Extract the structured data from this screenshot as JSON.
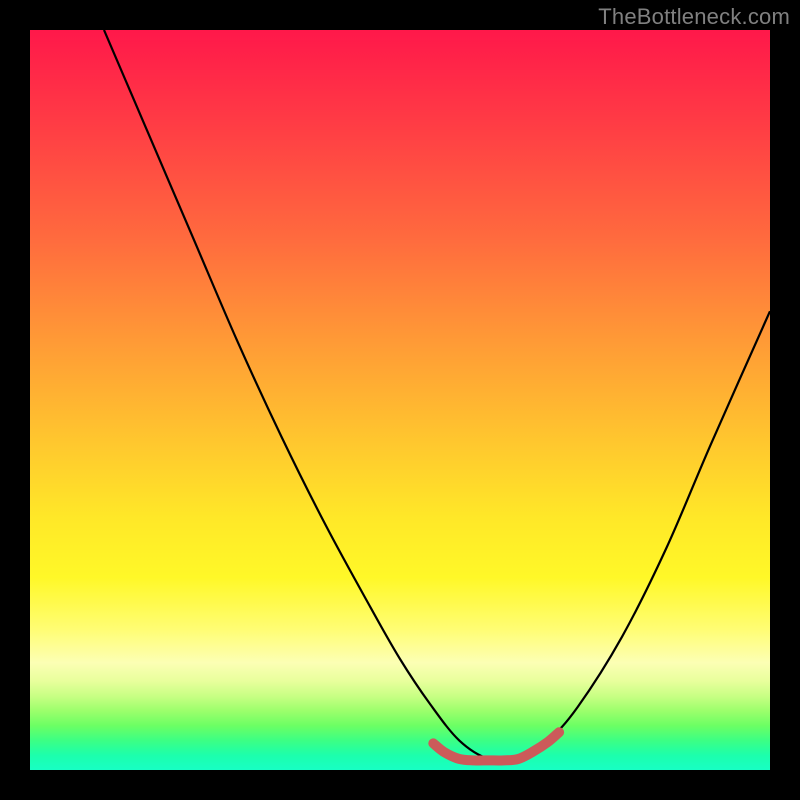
{
  "watermark": "TheBottleneck.com",
  "chart_data": {
    "type": "line",
    "title": "",
    "xlabel": "",
    "ylabel": "",
    "xlim": [
      0,
      100
    ],
    "ylim": [
      0,
      100
    ],
    "grid": false,
    "series": [
      {
        "name": "curve",
        "color": "#000000",
        "x": [
          10,
          16,
          22,
          28,
          34,
          40,
          46,
          50,
          54,
          58,
          62,
          66,
          70,
          74,
          80,
          86,
          92,
          100
        ],
        "y": [
          100,
          86,
          72,
          58,
          45,
          33,
          22,
          15,
          9,
          4,
          1.5,
          1.5,
          4,
          8.5,
          18,
          30,
          44,
          62
        ]
      },
      {
        "name": "highlight",
        "color": "#cc5a5a",
        "x": [
          54.5,
          56,
          58,
          60,
          62,
          64,
          66,
          68,
          70,
          71.5
        ],
        "y": [
          3.6,
          2.4,
          1.5,
          1.3,
          1.3,
          1.3,
          1.5,
          2.5,
          3.8,
          5.1
        ]
      }
    ],
    "background_gradient": {
      "stops": [
        {
          "pos": 0,
          "color": "#ff184a"
        },
        {
          "pos": 0.6,
          "color": "#ffe828"
        },
        {
          "pos": 0.86,
          "color": "#fcffb4"
        },
        {
          "pos": 1.0,
          "color": "#18ffc4"
        }
      ]
    }
  }
}
